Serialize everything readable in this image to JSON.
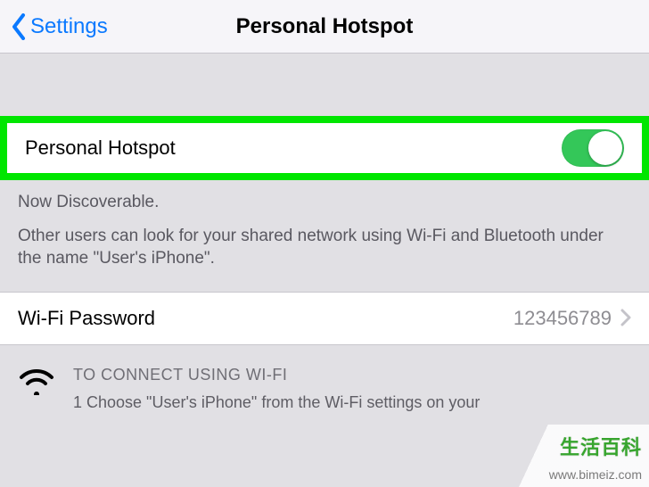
{
  "navbar": {
    "back_label": "Settings",
    "title": "Personal Hotspot"
  },
  "hotspot_row": {
    "label": "Personal Hotspot",
    "enabled": true
  },
  "discoverable": {
    "line1": "Now Discoverable.",
    "line2": "Other users can look for your shared network using Wi-Fi and Bluetooth under the name \"User's iPhone\"."
  },
  "password_row": {
    "label": "Wi-Fi Password",
    "value": "123456789"
  },
  "instructions": {
    "header": "TO CONNECT USING WI-FI",
    "step1": "1 Choose \"User's iPhone\" from the Wi-Fi settings on your"
  },
  "watermark": {
    "brand": "生活百科",
    "url": "www.bimeiz.com"
  }
}
